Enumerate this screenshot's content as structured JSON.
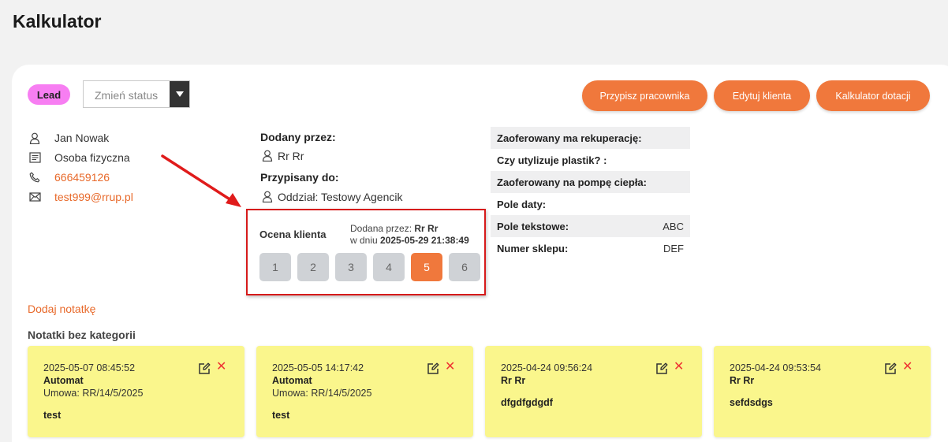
{
  "page": {
    "title": "Kalkulator"
  },
  "status": {
    "badge": "Lead",
    "select_placeholder": "Zmień status"
  },
  "actions": {
    "assign_label": "Przypisz pracownika",
    "edit_label": "Edytuj klienta",
    "grant_calc_label": "Kalkulator dotacji"
  },
  "client": {
    "name": "Jan Nowak",
    "type": "Osoba fizyczna",
    "phone": "666459126",
    "email": "test999@rrup.pl"
  },
  "meta": {
    "added_by_label": "Dodany przez:",
    "added_by": "Rr Rr",
    "assigned_to_label": "Przypisany do:",
    "assigned_to": "Oddział: Testowy Agencik"
  },
  "rating": {
    "title": "Ocena klienta",
    "added_by_prefix": "Dodana przez:",
    "added_by": "Rr Rr",
    "date_prefix": "w dniu",
    "date": "2025-05-29 21:38:49",
    "options": [
      "1",
      "2",
      "3",
      "4",
      "5",
      "6"
    ],
    "selected": "5"
  },
  "properties": [
    {
      "key": "Zaoferowany ma rekuperację:",
      "value": ""
    },
    {
      "key": "Czy utylizuje plastik? :",
      "value": ""
    },
    {
      "key": "Zaoferowany na pompę ciepła:",
      "value": ""
    },
    {
      "key": "Pole daty:",
      "value": ""
    },
    {
      "key": "Pole tekstowe:",
      "value": "ABC"
    },
    {
      "key": "Numer sklepu:",
      "value": "DEF"
    }
  ],
  "notes_section": {
    "add_label": "Dodaj notatkę",
    "heading": "Notatki bez kategorii",
    "notes": [
      {
        "date": "2025-05-07 08:45:52",
        "author": "Automat",
        "contract": "Umowa: RR/14/5/2025",
        "body": "test"
      },
      {
        "date": "2025-05-05 14:17:42",
        "author": "Automat",
        "contract": "Umowa: RR/14/5/2025",
        "body": "test"
      },
      {
        "date": "2025-04-24 09:56:24",
        "author": "Rr Rr",
        "contract": "",
        "body": "dfgdfgdgdf"
      },
      {
        "date": "2025-04-24 09:53:54",
        "author": "Rr Rr",
        "contract": "",
        "body": "sefdsdgs"
      }
    ]
  },
  "colors": {
    "accent": "#f0783c",
    "lead_badge": "#f77ef2",
    "note_bg": "#faf68c",
    "highlight_border": "#d61a1a"
  }
}
